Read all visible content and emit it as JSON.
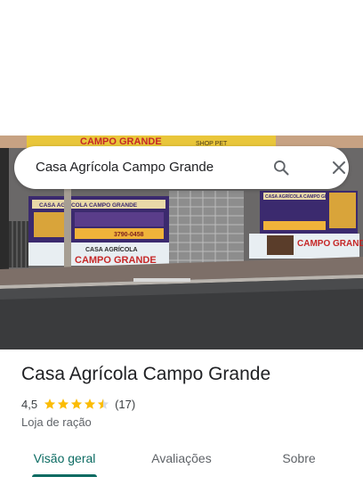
{
  "search": {
    "query": "Casa Agrícola Campo Grande",
    "search_icon": "search-icon",
    "close_icon": "close-icon"
  },
  "photo": {
    "sign_top": "CAMPO GRANDE",
    "sign_top_small": "SHOP PET",
    "banner_left": "CASA AGRÍCOLA CAMPO GRANDE",
    "banner_right": "CASA AGRÍCOLA CAMPO GRANDE",
    "phone": "3790-0458",
    "lower_small": "CASA AGRÍCOLA",
    "lower_big": "CAMPO GRANDE",
    "lower_right": "CAMPO GRANDE"
  },
  "place": {
    "name": "Casa Agrícola Campo Grande",
    "rating": "4,5",
    "rating_value": 4.5,
    "reviews": "(17)",
    "category": "Loja de ração",
    "star_color": "#fbbc04"
  },
  "tabs": [
    {
      "label": "Visão geral",
      "active": true
    },
    {
      "label": "Avaliações",
      "active": false
    },
    {
      "label": "Sobre",
      "active": false
    }
  ],
  "colors": {
    "accent": "#0b6b62"
  }
}
